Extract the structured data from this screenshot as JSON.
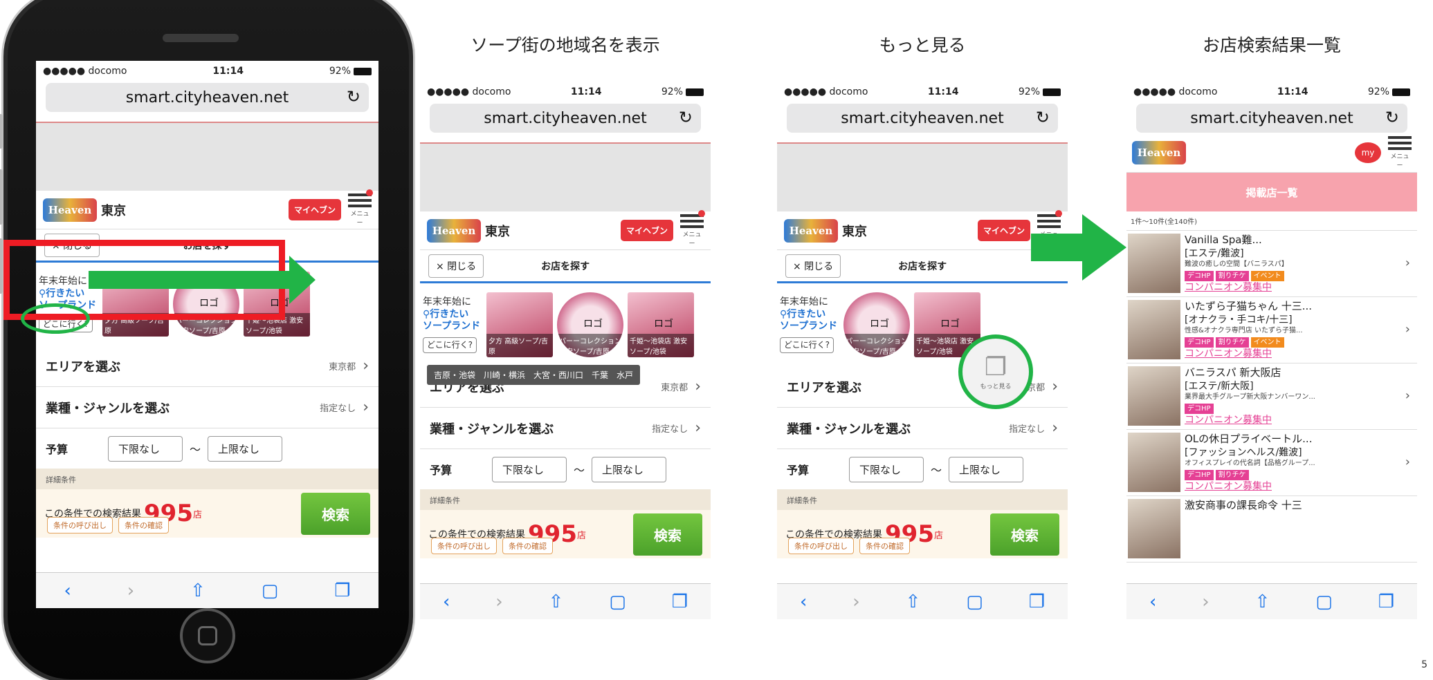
{
  "page_number": "5",
  "titles": {
    "panel2": "ソープ街の地域名を表示",
    "panel3": "もっと見る",
    "panel4": "お店検索結果一覧"
  },
  "status": {
    "carrier": "●●●●● docomo",
    "time": "11:14",
    "battery": "92%"
  },
  "url": "smart.cityheaven.net",
  "header": {
    "logo": "Heaven",
    "area": "東京",
    "myheaven": "マイヘブン",
    "menu": "メニュー"
  },
  "finder": {
    "close": "× 閉じる",
    "title": "お店を探す"
  },
  "promo": {
    "line1": "年末年始に",
    "line2": "行きたい",
    "line3": "ソープランド",
    "where": "どこに行く?"
  },
  "tiles": [
    {
      "caption": "夕方 高級ソープ/吉原",
      "logo": ""
    },
    {
      "caption": "パーーコレクション 激安ソープ/吉原",
      "logo": "ロゴ"
    },
    {
      "caption": "千姫〜池袋店 激安ソープ/池袋",
      "logo": "ロゴ"
    }
  ],
  "tooltip": "吉原・池袋　川崎・横浜　大宮・西川口　千葉　水戸",
  "rows": {
    "area": {
      "label": "エリアを選ぶ",
      "value": "東京都"
    },
    "genre": {
      "label": "業種・ジャンルを選ぶ",
      "value": "指定なし"
    }
  },
  "budget": {
    "label": "予算",
    "min": "下限なし",
    "tilde": "〜",
    "max": "上限なし"
  },
  "detail": "詳細条件",
  "result": {
    "prefix": "この条件での検索結果",
    "count": "995",
    "unit": "店",
    "recall": "条件の呼び出し",
    "confirm": "条件の確認",
    "search": "検索"
  },
  "more_label": "もっと見る",
  "list": {
    "header_label": "掲載店一覧",
    "count": "1件〜10件(全140件)",
    "shops": [
      {
        "name": "Vanilla Spa難...",
        "genre": "[エステ/難波]",
        "desc": "難波の癒しの空間【バニラスパ】",
        "tags": [
          "デコHP",
          "割りチケ",
          "イベント"
        ],
        "recruit": "コンパニオン募集中"
      },
      {
        "name": "いたずら子猫ちゃん 十三...",
        "genre": "[オナクラ・手コキ/十三]",
        "desc": "性感&オナクラ専門店 いたずら子猫...",
        "tags": [
          "デコHP",
          "割りチケ",
          "イベント"
        ],
        "recruit": "コンパニオン募集中"
      },
      {
        "name": "バニラスパ 新大阪店",
        "genre": "[エステ/新大阪]",
        "desc": "業界最大手グループ新大阪ナンバーワン...",
        "tags": [
          "デコHP"
        ],
        "recruit": "コンパニオン募集中"
      },
      {
        "name": "OLの休日プライベートル...",
        "genre": "[ファッションヘルス/難波]",
        "desc": "オフィスプレイの代名詞【品格グループ...",
        "tags": [
          "デコHP",
          "割りチケ"
        ],
        "recruit": "コンパニオン募集中"
      },
      {
        "name": "激安商事の課長命令 十三",
        "genre": "",
        "desc": "",
        "tags": [],
        "recruit": ""
      }
    ],
    "my": "my",
    "menu": "メニュー"
  },
  "toolbar_icons": [
    "back-icon",
    "forward-icon",
    "share-icon",
    "bookmarks-icon",
    "tabs-icon"
  ],
  "colors": {
    "red_frame": "#ee1c24",
    "green_arrow": "#21b447",
    "brand_red": "#e6353b",
    "result_red": "#e0242f"
  }
}
